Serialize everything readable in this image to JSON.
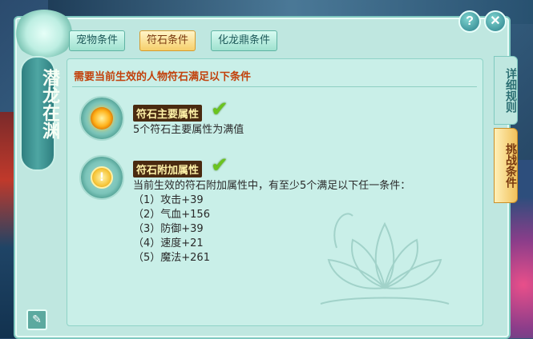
{
  "panel": {
    "title": "潜龙在渊",
    "tabs": [
      {
        "label": "宠物条件",
        "active": false
      },
      {
        "label": "符石条件",
        "active": true
      },
      {
        "label": "化龙鼎条件",
        "active": false
      }
    ],
    "side_tabs": [
      "详细规则",
      "挑战条件"
    ],
    "help_label": "?",
    "close_label": "✕",
    "headline": "需要当前生效的人物符石满足以下条件",
    "conditions": [
      {
        "title": "符石主要属性",
        "met": true,
        "description": "5个符石主要属性为满值",
        "icon": "sun-orb-icon"
      },
      {
        "title": "符石附加属性",
        "met": true,
        "description": "当前生效的符石附加属性中，有至少5个满足以下任一条件：",
        "icon": "shield-orb-icon",
        "options": [
          "（1）攻击+39",
          "（2）气血+156",
          "（3）防御+39",
          "（4）速度+21",
          "（5）魔法+261"
        ]
      }
    ]
  },
  "colors": {
    "headline": "#c2410c",
    "check": "#6bc41e",
    "active_tab": "#f6cf6b",
    "frame": "#bfe7e0"
  }
}
